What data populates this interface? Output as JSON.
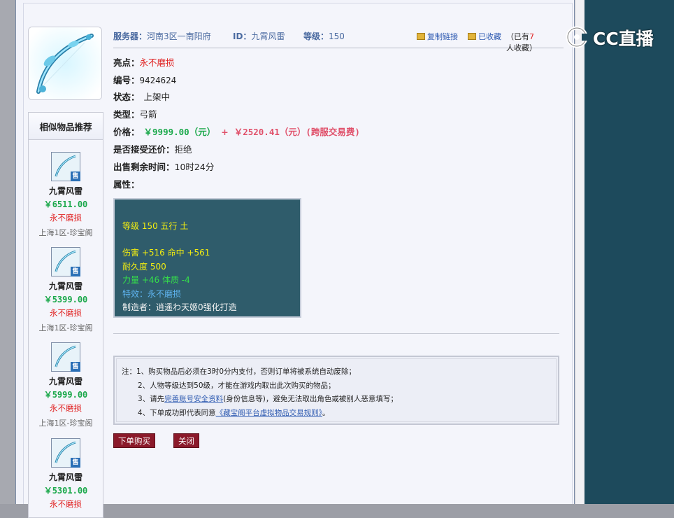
{
  "header": {
    "server_label": "服务器：",
    "server_value": "河南3区一南阳府",
    "id_label": "ID：",
    "id_value": "九霄风雷",
    "level_label": "等级：",
    "level_value": "150",
    "copy_link": "复制链接",
    "favorited": "已收藏",
    "fav_count_prefix": "（已有",
    "fav_count": "7",
    "fav_count_suffix": "人收藏）"
  },
  "fields": {
    "highlight_label": "亮点：",
    "highlight_value": "永不磨损",
    "number_label": "编号：",
    "number_value": "9424624",
    "status_label": "状态：",
    "status_value": "上架中",
    "type_label": "类型：",
    "type_value": "弓箭",
    "price_label": "价格：",
    "price_main": "￥9999.00（元）",
    "price_plus": "+",
    "price_fee": "￥2520.41（元）(跨服交易费)",
    "counter_label": "是否接受还价：",
    "counter_value": "拒绝",
    "remaining_label": "出售剩余时间：",
    "remaining_value": "10时24分",
    "attr_label": "属性："
  },
  "attributes": {
    "line1": "等级 150 五行 土",
    "line2": "伤害 +516 命中 +561",
    "line3": "耐久度 500",
    "line4": "力量 +46 体质 -4",
    "line5": "特效：永不磨损",
    "line6": "制造者：逍遥わ天姬0强化打造"
  },
  "similar": {
    "title": "相似物品推荐",
    "badge": "售",
    "items": [
      {
        "name": "九霄风雷",
        "price": "￥6511.00",
        "feature": "永不磨损",
        "server": "上海1区-珍宝阁"
      },
      {
        "name": "九霄风雷",
        "price": "￥5399.00",
        "feature": "永不磨损",
        "server": "上海1区-珍宝阁"
      },
      {
        "name": "九霄风雷",
        "price": "￥5999.00",
        "feature": "永不磨损",
        "server": "上海1区-珍宝阁"
      },
      {
        "name": "九霄风雷",
        "price": "￥5301.00",
        "feature": "永不磨损",
        "server": ""
      }
    ]
  },
  "notes": {
    "n1": "注：1、购买物品后必须在3时0分内支付，否则订单将被系统自动废除；",
    "n2": "2、人物等级达到50级，才能在游戏内取出此次购买的物品；",
    "n3_pre": "3、请先",
    "n3_link": "完善账号安全资料",
    "n3_post": "(身份信息等)，避免无法取出角色或被别人恶意填写；",
    "n4_pre": "4、下单成功即代表同意",
    "n4_link": "《藏宝阁平台虚拟物品交易规则》",
    "n4_post": "。"
  },
  "buttons": {
    "buy": "下单购买",
    "close": "关闭"
  },
  "logo": {
    "text": "CC直播"
  },
  "colors": {
    "price_green": "#1aa84a",
    "price_red": "#e0506a",
    "attr_bg": "#2f5c6b",
    "button_bg": "#8b1a2a",
    "side_panel": "#1d4a5c"
  }
}
